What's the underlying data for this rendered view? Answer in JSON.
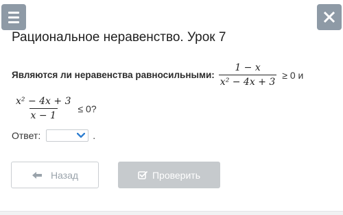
{
  "header": {
    "menu_icon": "hamburger-menu-icon",
    "close_icon": "close-icon"
  },
  "lesson": {
    "title": "Рациональное неравенство. Урок 7"
  },
  "question": {
    "text": "Являются ли неравенства равносильными:",
    "ineq1": {
      "numerator": "1 − x",
      "denominator": "x² − 4x + 3",
      "relation": "≥ 0 и"
    },
    "ineq2": {
      "numerator": "x² − 4x + 3",
      "denominator": "x − 1",
      "relation": "≤ 0?"
    }
  },
  "answer": {
    "label": "Ответ:",
    "selected": "",
    "suffix": ".",
    "chevron_icon": "chevron-down-icon"
  },
  "buttons": {
    "back_label": "Назад",
    "back_icon": "arrow-left-icon",
    "check_label": "Проверить",
    "check_icon": "checkbox-edit-icon"
  },
  "colors": {
    "header_button": "#8e9aa6",
    "check_button_disabled": "#c6cacd",
    "chevron": "#2f7fd1"
  }
}
